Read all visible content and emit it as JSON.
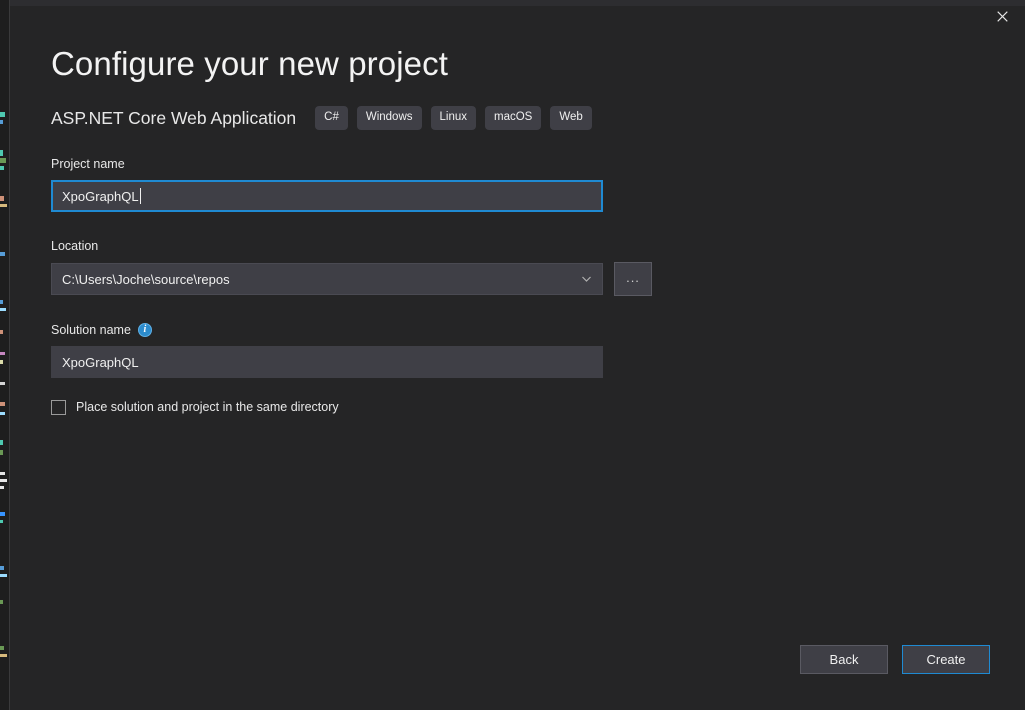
{
  "window": {
    "close_icon": "close-icon"
  },
  "header": {
    "title": "Configure your new project",
    "subtitle": "ASP.NET Core Web Application",
    "tags": [
      "C#",
      "Windows",
      "Linux",
      "macOS",
      "Web"
    ]
  },
  "form": {
    "project_name": {
      "label": "Project name",
      "value": "XpoGraphQL",
      "placeholder": ""
    },
    "location": {
      "label": "Location",
      "value": "C:\\Users\\Joche\\source\\repos",
      "chevron_icon": "chevron-down-icon",
      "browse_label": "...",
      "browse_icon": "ellipsis-icon"
    },
    "solution_name": {
      "label": "Solution name",
      "value": "XpoGraphQL",
      "placeholder": "",
      "info_icon": "info-icon",
      "info_glyph": "i"
    },
    "same_directory": {
      "label": "Place solution and project in the same directory",
      "checked": false
    }
  },
  "footer": {
    "back_label": "Back",
    "create_label": "Create"
  },
  "colors": {
    "dialog_background": "#252526",
    "desktop_background": "#1e1e1e",
    "input_background": "#3f3f46",
    "accent": "#1f8ad2",
    "tag_background": "#3f3f46",
    "text_primary": "#f0f0f0",
    "info_icon": "#2d8ccd"
  }
}
